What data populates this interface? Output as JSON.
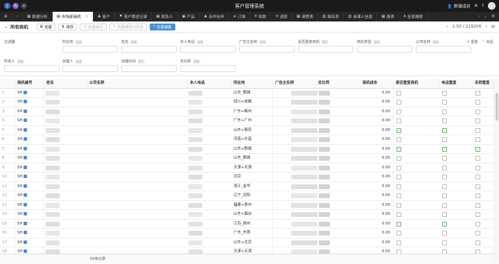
{
  "app": {
    "title": "客户管理系统",
    "add_member": "新增成员",
    "help": "?",
    "search_icon": "search-icon"
  },
  "tabs": [
    {
      "label": "数据分析",
      "icon": "chart-icon",
      "active": false
    },
    {
      "label": "市场部商机",
      "icon": "doc-icon",
      "active": true
    },
    {
      "label": "客户",
      "icon": "user-icon",
      "active": false
    },
    {
      "label": "客户跟进记录",
      "icon": "flag-icon",
      "active": false
    },
    {
      "label": "联系人",
      "icon": "grid-icon",
      "active": false
    },
    {
      "label": "产品",
      "icon": "box-icon",
      "active": false
    },
    {
      "label": "合作伙伴",
      "icon": "user-icon",
      "active": false
    },
    {
      "label": "订单",
      "icon": "cart-icon",
      "active": false
    },
    {
      "label": "收款",
      "icon": "money-icon",
      "active": false
    },
    {
      "label": "退款",
      "icon": "refund-icon",
      "active": false
    },
    {
      "label": "课程表",
      "icon": "grid-icon",
      "active": false
    },
    {
      "label": "报名表",
      "icon": "table-icon",
      "active": false
    },
    {
      "label": "参课人信息",
      "icon": "table-icon",
      "active": false
    },
    {
      "label": "报表",
      "icon": "chart-icon",
      "active": false
    },
    {
      "label": "全局搜索",
      "icon": "A-icon",
      "active": false
    }
  ],
  "toolbar": {
    "view": "所有商机",
    "create": "创建",
    "sort": "排序",
    "batch": "批量操作",
    "batch_edit": "批量编辑与修改",
    "search_btn": "全局搜索",
    "pager": "1-50 / 219206"
  },
  "filters": {
    "row1": [
      {
        "label": "过滤器",
        "tag": ""
      },
      {
        "label": "所在地",
        "tag": "包含"
      },
      {
        "label": "姓名",
        "tag": "包含"
      },
      {
        "label": "本人电话",
        "tag": "包含"
      },
      {
        "label": "广告主名称",
        "tag": "包含"
      },
      {
        "label": "是否重复商机",
        "tag": "等于"
      },
      {
        "label": "商机类型",
        "tag": "包含"
      },
      {
        "label": "公司名称",
        "tag": "包含"
      }
    ],
    "row2": [
      {
        "label": "所有人",
        "tag": "包含"
      },
      {
        "label": "创建人",
        "tag": "包含"
      },
      {
        "label": "创建时间",
        "tag": "等于"
      },
      {
        "label": "优化师",
        "tag": "包含"
      }
    ],
    "reset": "重置",
    "collapse": "收起"
  },
  "columns": [
    "商机编号",
    "姓名",
    "公司名称",
    "本人电话",
    "所在地",
    "广告主名称",
    "优化师",
    "商机成本",
    "是否重复商机",
    "电话重复",
    "名称重复"
  ],
  "rows": [
    {
      "n": "1",
      "id": "SH",
      "loc": "山东_聊城",
      "cost": "0.00",
      "dup": false,
      "phone": false,
      "name": false
    },
    {
      "n": "2",
      "id": "SH",
      "loc": "四川+成都",
      "cost": "0.00",
      "dup": false,
      "phone": false,
      "name": false
    },
    {
      "n": "3",
      "id": "SH",
      "loc": "广东+梅州",
      "cost": "0.00",
      "dup": false,
      "phone": false,
      "name": false
    },
    {
      "n": "4",
      "id": "SH",
      "loc": "广东+广州",
      "cost": "0.00",
      "dup": false,
      "phone": false,
      "name": false
    },
    {
      "n": "5",
      "id": "SH",
      "loc": "山东+泰安",
      "cost": "0.00",
      "dup": true,
      "phone": true,
      "name": false
    },
    {
      "n": "6",
      "id": "SH",
      "loc": "河南+许昌",
      "cost": "0.00",
      "dup": false,
      "phone": false,
      "name": false
    },
    {
      "n": "7",
      "id": "SH",
      "loc": "山东+聊城",
      "cost": "0.00",
      "dup": true,
      "phone": true,
      "name": true
    },
    {
      "n": "8",
      "id": "SH",
      "loc": "山东_聊城",
      "cost": "0.00",
      "dup": false,
      "phone": false,
      "name": false
    },
    {
      "n": "9",
      "id": "SH",
      "loc": "天津+天津",
      "cost": "0.00",
      "dup": false,
      "phone": false,
      "name": false
    },
    {
      "n": "10",
      "id": "SH",
      "loc": "北京",
      "cost": "0.00",
      "dup": false,
      "phone": false,
      "name": false
    },
    {
      "n": "11",
      "id": "SH",
      "loc": "浙江_金华",
      "cost": "0.00",
      "dup": false,
      "phone": false,
      "name": false
    },
    {
      "n": "12",
      "id": "SH",
      "loc": "辽宁_沈阳",
      "cost": "0.00",
      "dup": false,
      "phone": false,
      "name": false
    },
    {
      "n": "13",
      "id": "SH",
      "loc": "福建+泉州",
      "cost": "0.00",
      "dup": false,
      "phone": false,
      "name": false
    },
    {
      "n": "14",
      "id": "SH",
      "loc": "山东+烟台",
      "cost": "0.00",
      "dup": false,
      "phone": false,
      "name": false
    },
    {
      "n": "15",
      "id": "SH",
      "loc": "江苏_扬州",
      "cost": "0.00",
      "dup": true,
      "phone": true,
      "name": false
    },
    {
      "n": "16",
      "id": "SH",
      "loc": "广东_东莞",
      "cost": "0.00",
      "dup": false,
      "phone": false,
      "name": false
    },
    {
      "n": "17",
      "id": "SH",
      "loc": "山东+北京",
      "cost": "0.00",
      "dup": false,
      "phone": false,
      "name": false
    },
    {
      "n": "18",
      "id": "SH",
      "loc": "天津+天津",
      "cost": "0.00",
      "dup": false,
      "phone": false,
      "name": false
    }
  ],
  "footer": "50条记录",
  "colors": {
    "accent": "#4a8fd6",
    "check": "#5cb85c",
    "titlebar": "#1a1a1a",
    "tabbar": "#262626"
  }
}
